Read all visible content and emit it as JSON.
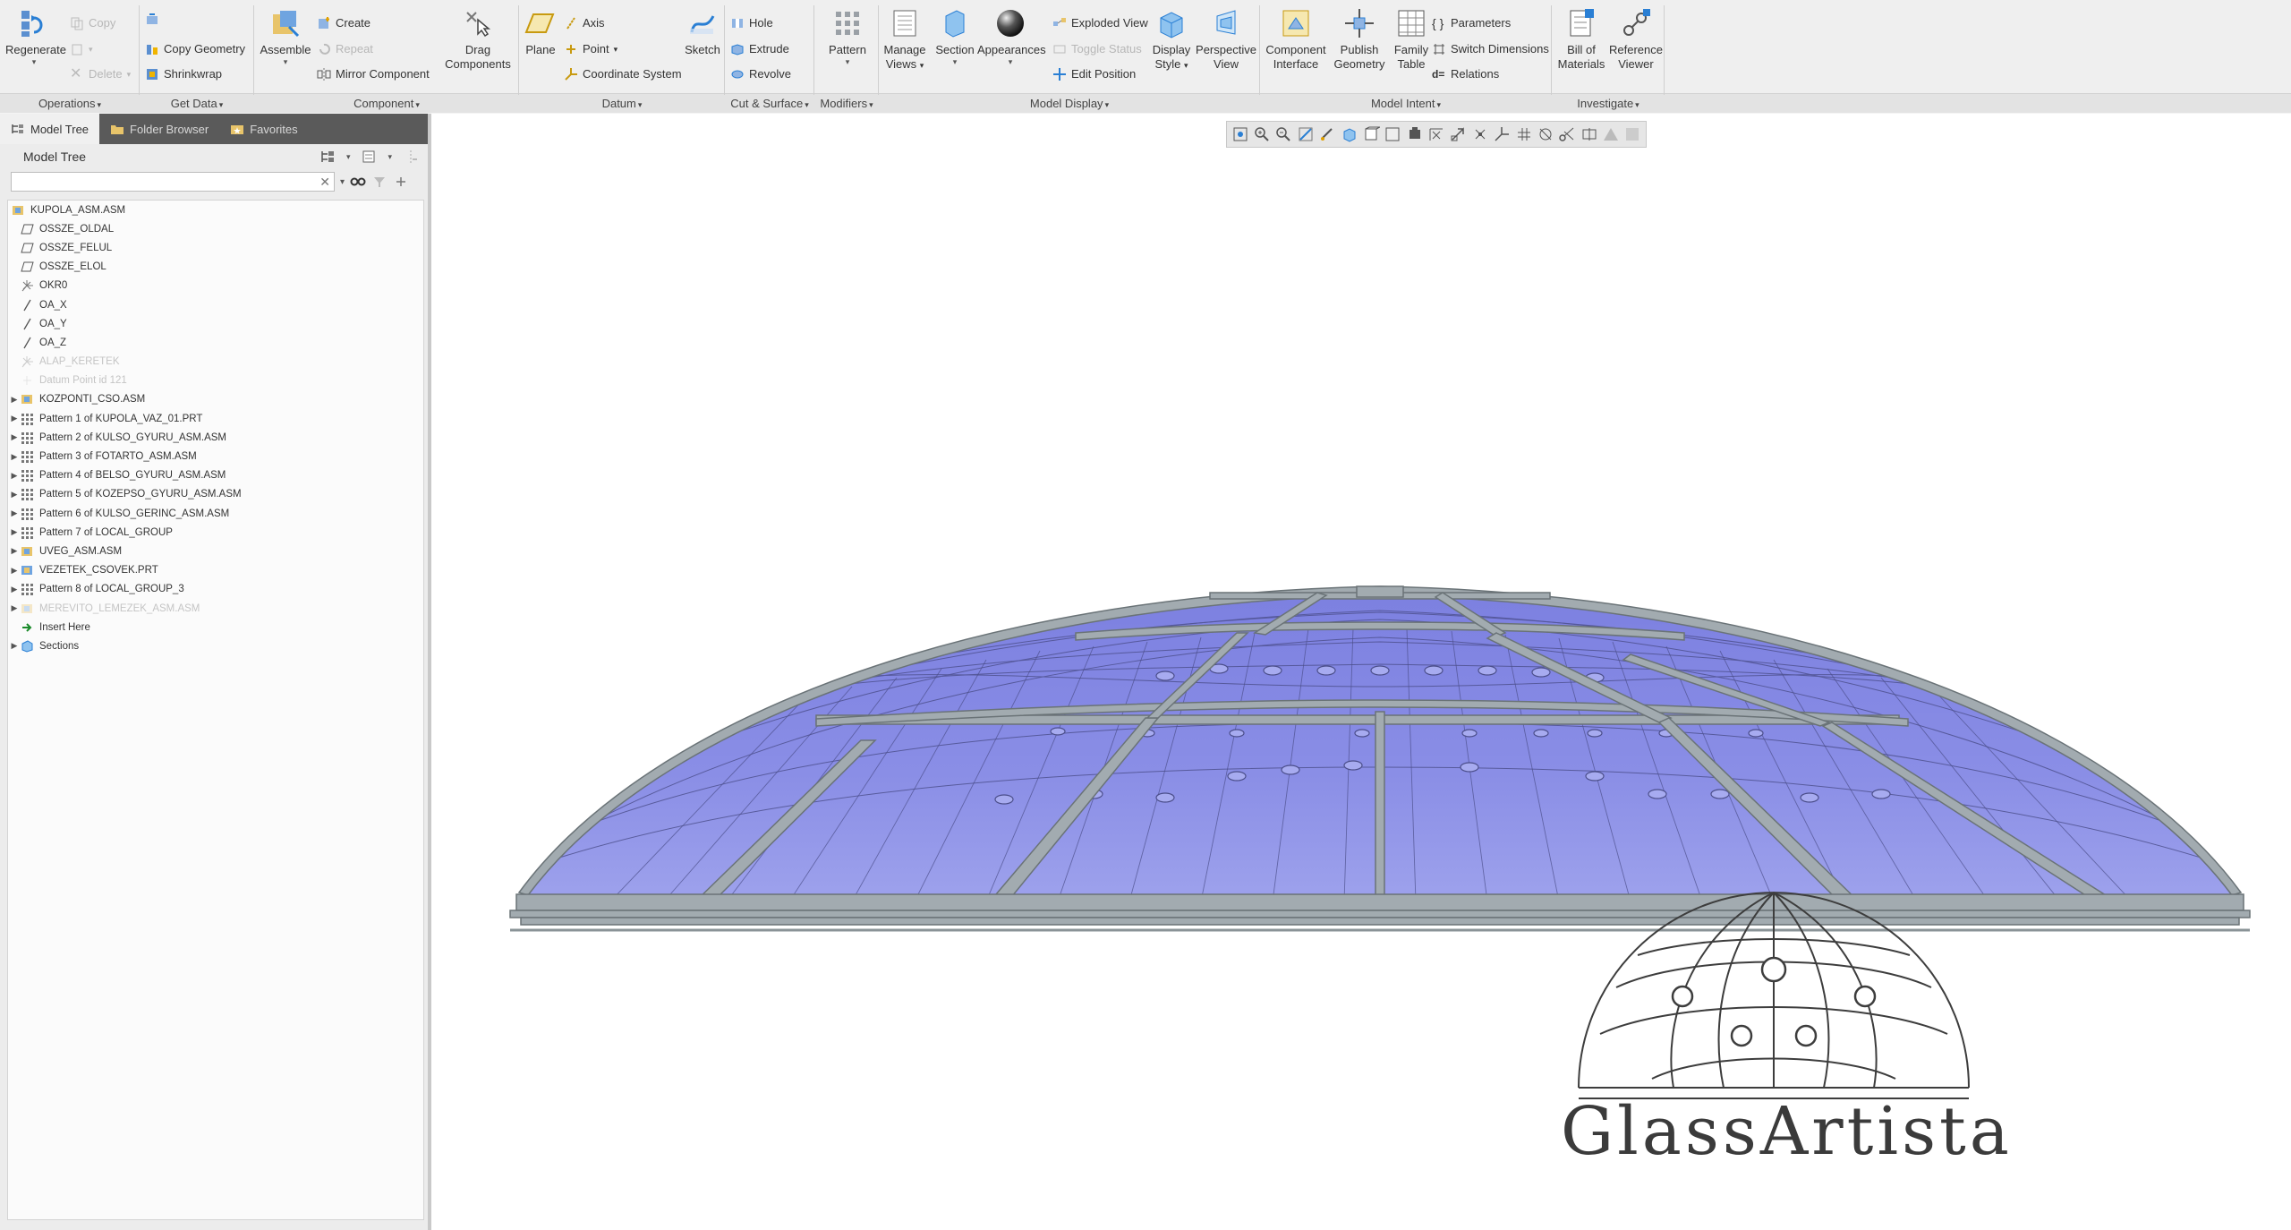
{
  "ribbon": {
    "operations": {
      "label": "Operations",
      "regenerate": "Regenerate",
      "copy": "Copy",
      "delete": "Delete"
    },
    "get_data": {
      "label": "Get Data",
      "copy_geometry": "Copy Geometry",
      "shrinkwrap": "Shrinkwrap"
    },
    "component": {
      "label": "Component",
      "assemble": "Assemble",
      "create": "Create",
      "repeat": "Repeat",
      "mirror_component": "Mirror Component",
      "drag_components_1": "Drag",
      "drag_components_2": "Components"
    },
    "datum": {
      "label": "Datum",
      "plane": "Plane",
      "axis": "Axis",
      "point": "Point",
      "coordinate_system": "Coordinate System",
      "sketch": "Sketch"
    },
    "cut_surface": {
      "label": "Cut & Surface",
      "hole": "Hole",
      "extrude": "Extrude",
      "revolve": "Revolve"
    },
    "modifiers": {
      "label": "Modifiers",
      "pattern": "Pattern"
    },
    "model_display": {
      "label": "Model Display",
      "manage_views_1": "Manage",
      "manage_views_2": "Views",
      "section": "Section",
      "appearances": "Appearances",
      "exploded_view": "Exploded View",
      "toggle_status": "Toggle Status",
      "edit_position": "Edit Position",
      "display_style_1": "Display",
      "display_style_2": "Style",
      "perspective_view_1": "Perspective",
      "perspective_view_2": "View"
    },
    "model_intent": {
      "label": "Model Intent",
      "component_interface_1": "Component",
      "component_interface_2": "Interface",
      "publish_geometry_1": "Publish",
      "publish_geometry_2": "Geometry",
      "family_table_1": "Family",
      "family_table_2": "Table",
      "parameters": "Parameters",
      "switch_dimensions": "Switch Dimensions",
      "relations": "Relations"
    },
    "investigate": {
      "label": "Investigate",
      "bill_of_materials_1": "Bill of",
      "bill_of_materials_2": "Materials",
      "reference_viewer_1": "Reference",
      "reference_viewer_2": "Viewer"
    }
  },
  "navigator": {
    "tabs": [
      "Model Tree",
      "Folder Browser",
      "Favorites"
    ],
    "tree_title": "Model Tree",
    "search_placeholder": ""
  },
  "tree": {
    "items": [
      {
        "label": "KUPOLA_ASM.ASM",
        "icon": "assembly-icon",
        "expand": false,
        "dim": false,
        "indent": 0
      },
      {
        "label": "OSSZE_OLDAL",
        "icon": "datum-plane-icon",
        "expand": false,
        "dim": false,
        "indent": 1
      },
      {
        "label": "OSSZE_FELUL",
        "icon": "datum-plane-icon",
        "expand": false,
        "dim": false,
        "indent": 1
      },
      {
        "label": "OSSZE_ELOL",
        "icon": "datum-plane-icon",
        "expand": false,
        "dim": false,
        "indent": 1
      },
      {
        "label": "OKR0",
        "icon": "coordinate-system-icon",
        "expand": false,
        "dim": false,
        "indent": 1
      },
      {
        "label": "OA_X",
        "icon": "datum-axis-icon",
        "expand": false,
        "dim": false,
        "indent": 1
      },
      {
        "label": "OA_Y",
        "icon": "datum-axis-icon",
        "expand": false,
        "dim": false,
        "indent": 1
      },
      {
        "label": "OA_Z",
        "icon": "datum-axis-icon",
        "expand": false,
        "dim": false,
        "indent": 1
      },
      {
        "label": "ALAP_KERETEK",
        "icon": "coordinate-system-icon",
        "expand": false,
        "dim": true,
        "indent": 1
      },
      {
        "label": "Datum Point id 121",
        "icon": "datum-point-icon",
        "expand": false,
        "dim": true,
        "indent": 1
      },
      {
        "label": "KOZPONTI_CSO.ASM",
        "icon": "assembly-icon",
        "expand": true,
        "dim": false,
        "indent": 1
      },
      {
        "label": "Pattern 1 of KUPOLA_VAZ_01.PRT",
        "icon": "pattern-icon",
        "expand": true,
        "dim": false,
        "indent": 1
      },
      {
        "label": "Pattern 2 of KULSO_GYURU_ASM.ASM",
        "icon": "pattern-icon",
        "expand": true,
        "dim": false,
        "indent": 1
      },
      {
        "label": "Pattern 3 of FOTARTO_ASM.ASM",
        "icon": "pattern-icon",
        "expand": true,
        "dim": false,
        "indent": 1
      },
      {
        "label": "Pattern 4 of BELSO_GYURU_ASM.ASM",
        "icon": "pattern-icon",
        "expand": true,
        "dim": false,
        "indent": 1
      },
      {
        "label": "Pattern 5 of KOZEPSO_GYURU_ASM.ASM",
        "icon": "pattern-icon",
        "expand": true,
        "dim": false,
        "indent": 1
      },
      {
        "label": "Pattern 6 of KULSO_GERINC_ASM.ASM",
        "icon": "pattern-icon",
        "expand": true,
        "dim": false,
        "indent": 1
      },
      {
        "label": "Pattern 7 of LOCAL_GROUP",
        "icon": "pattern-icon",
        "expand": true,
        "dim": false,
        "indent": 1
      },
      {
        "label": "UVEG_ASM.ASM",
        "icon": "assembly-icon",
        "expand": true,
        "dim": false,
        "indent": 1
      },
      {
        "label": "VEZETEK_CSOVEK.PRT",
        "icon": "part-icon",
        "expand": true,
        "dim": false,
        "indent": 1
      },
      {
        "label": "Pattern 8 of LOCAL_GROUP_3",
        "icon": "pattern-icon",
        "expand": true,
        "dim": false,
        "indent": 1
      },
      {
        "label": "MEREVITO_LEMEZEK_ASM.ASM",
        "icon": "assembly-icon",
        "expand": true,
        "dim": true,
        "indent": 1
      },
      {
        "label": "Insert Here",
        "icon": "insert-here-icon",
        "expand": false,
        "dim": false,
        "indent": 1
      },
      {
        "label": "Sections",
        "icon": "sections-icon",
        "expand": true,
        "dim": false,
        "indent": 1
      }
    ]
  },
  "logo": {
    "text": "GlassArtista"
  },
  "colors": {
    "glass": "#8a8ee6",
    "frame": "#9aa3a8",
    "accent_blue": "#2a7fd4"
  }
}
